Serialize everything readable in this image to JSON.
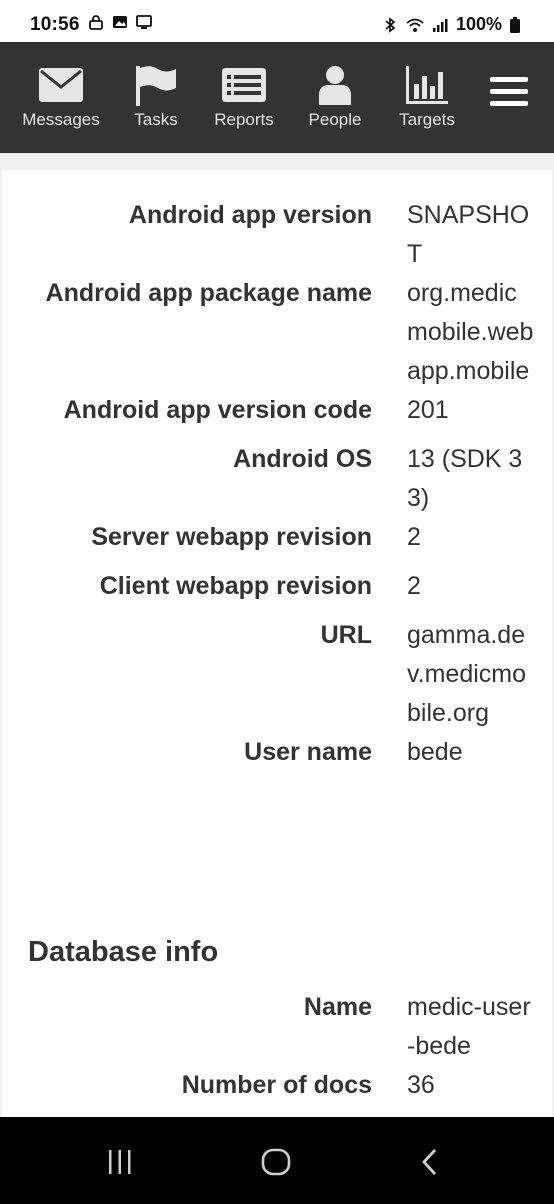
{
  "status_bar": {
    "time": "10:56",
    "battery": "100%"
  },
  "nav": {
    "items": [
      {
        "label": "Messages",
        "icon": "envelope-icon"
      },
      {
        "label": "Tasks",
        "icon": "flag-icon"
      },
      {
        "label": "Reports",
        "icon": "list-icon"
      },
      {
        "label": "People",
        "icon": "person-icon"
      },
      {
        "label": "Targets",
        "icon": "bar-chart-icon"
      }
    ],
    "menu_icon": "hamburger-menu-icon"
  },
  "app_info": {
    "rows": [
      {
        "key": "Android app version",
        "value": "SNAPSHOT"
      },
      {
        "key": "Android app package name",
        "value": "org.medicmobile.webapp.mobile"
      },
      {
        "key": "Android app version code",
        "value": "201"
      },
      {
        "key": "Android OS",
        "value": "13 (SDK 33)"
      },
      {
        "key": "Server webapp revision",
        "value": "2"
      },
      {
        "key": "Client webapp revision",
        "value": "2"
      },
      {
        "key": "URL",
        "value": "gamma.dev.medicmobile.org"
      },
      {
        "key": "User name",
        "value": "bede"
      }
    ]
  },
  "database_info": {
    "title": "Database info",
    "rows": [
      {
        "key": "Name",
        "value": "medic-user-bede"
      },
      {
        "key": "Number of docs",
        "value": "36"
      }
    ]
  },
  "colors": {
    "navbar_bg": "#333333",
    "text": "#333333",
    "page_bg": "#efefef"
  }
}
